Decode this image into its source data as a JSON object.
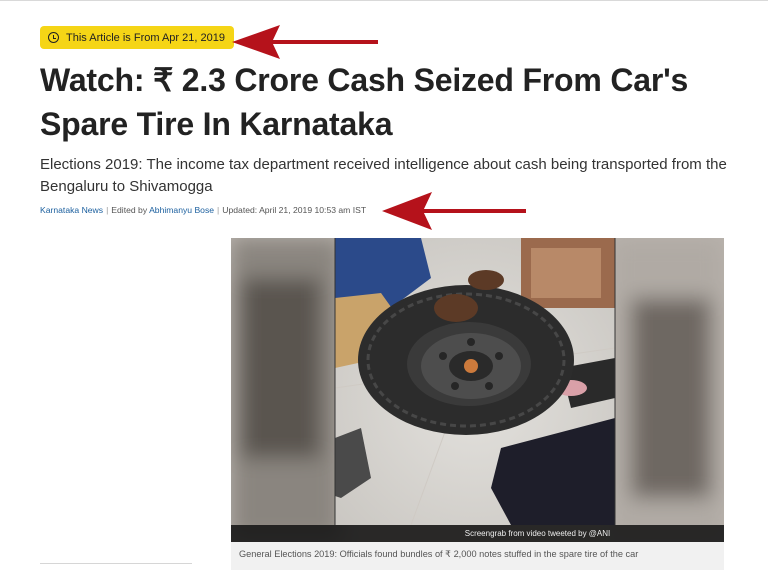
{
  "badge": {
    "icon": "clock-icon",
    "label": "This Article is From Apr 21, 2019",
    "color": "#f5d516"
  },
  "headline": "Watch: ₹ 2.3 Crore Cash Seized From Car's Spare Tire In Karnataka",
  "summary": "Elections 2019: The income tax department received intelligence about cash being transported from the Bengaluru to Shivamogga",
  "byline": {
    "category": "Karnataka News",
    "edited_prefix": "Edited by",
    "editor": "Abhimanyu Bose",
    "updated": "Updated: April 21, 2019 10:53 am IST"
  },
  "image": {
    "credit": "Screengrab from video tweeted by @ANI",
    "caption": "General Elections 2019: Officials found bundles of ₹ 2,000 notes stuffed in the spare tire of the car"
  },
  "annotation_color": "#b5121b"
}
